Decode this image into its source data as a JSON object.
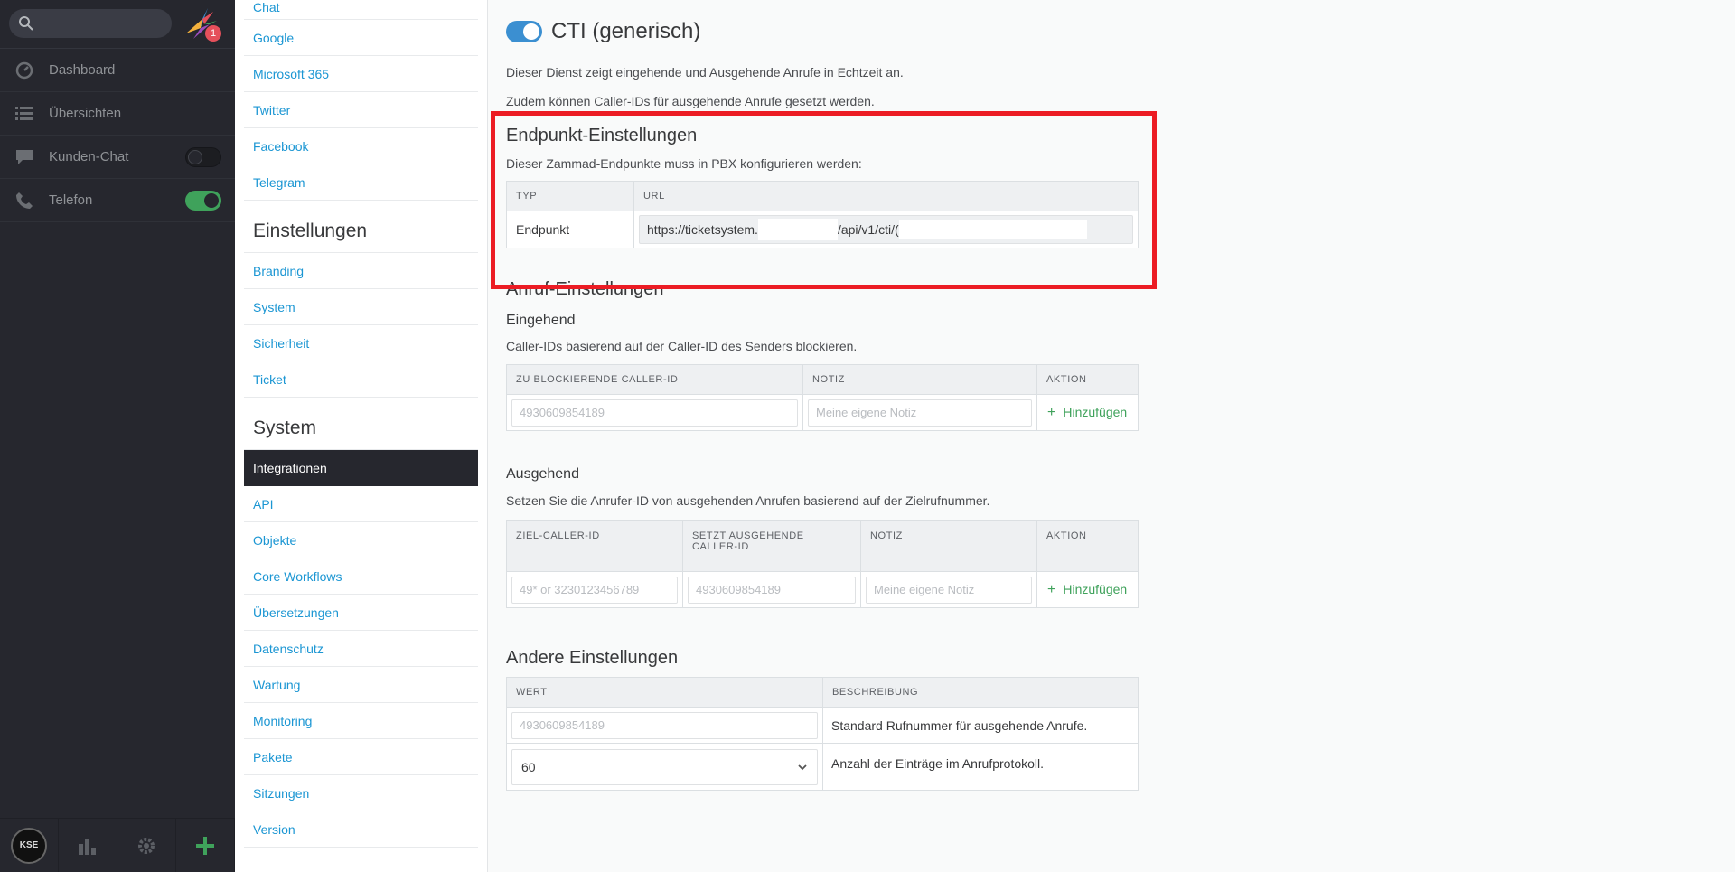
{
  "nav": {
    "search_placeholder": "",
    "notification_count": "1",
    "items": [
      {
        "label": "Dashboard",
        "icon": "dashboard-icon"
      },
      {
        "label": "Übersichten",
        "icon": "list-icon"
      },
      {
        "label": "Kunden-Chat",
        "icon": "chat-icon",
        "toggle": "off"
      },
      {
        "label": "Telefon",
        "icon": "phone-icon",
        "toggle": "on"
      }
    ],
    "bottom": [
      "avatar",
      "reports-icon",
      "gear-icon",
      "plus-icon"
    ],
    "avatar_text": "KSE"
  },
  "sidebar": {
    "channels": [
      "Chat",
      "Google",
      "Microsoft 365",
      "Twitter",
      "Facebook",
      "Telegram"
    ],
    "group_settings": "Einstellungen",
    "settings": [
      "Branding",
      "System",
      "Sicherheit",
      "Ticket"
    ],
    "group_system": "System",
    "system": [
      "Integrationen",
      "API",
      "Objekte",
      "Core Workflows",
      "Übersetzungen",
      "Datenschutz",
      "Wartung",
      "Monitoring",
      "Pakete",
      "Sitzungen",
      "Version"
    ]
  },
  "main": {
    "title": "CTI (generisch)",
    "enabled": true,
    "desc1": "Dieser Dienst zeigt eingehende und Ausgehende Anrufe in Echtzeit an.",
    "desc2": "Zudem können Caller-IDs für ausgehende Anrufe gesetzt werden.",
    "endpoint": {
      "heading": "Endpunkt-Einstellungen",
      "desc": "Dieser Zammad-Endpunkte muss in PBX konfigurieren werden:",
      "col_type": "TYP",
      "col_url": "URL",
      "row_type": "Endpunkt",
      "url_start": "https://ticketsystem.",
      "url_mid": "/api/v1/cti/",
      "url_tail": "("
    },
    "call": {
      "heading": "Anruf-Einstellungen",
      "incoming": {
        "heading": "Eingehend",
        "desc": "Caller-IDs basierend auf der Caller-ID des Senders blockieren.",
        "cols": [
          "ZU BLOCKIERENDE CALLER-ID",
          "NOTIZ",
          "AKTION"
        ],
        "callerid_placeholder": "4930609854189",
        "note_placeholder": "Meine eigene Notiz",
        "add_label": "Hinzufügen"
      },
      "outgoing": {
        "heading": "Ausgehend",
        "desc": "Setzen Sie die Anrufer-ID von ausgehenden Anrufen basierend auf der Zielrufnummer.",
        "cols": [
          "ZIEL-CALLER-ID",
          "SETZT AUSGEHENDE CALLER-ID",
          "NOTIZ",
          "AKTION"
        ],
        "dest_placeholder": "49* or 3230123456789",
        "callerid_placeholder": "4930609854189",
        "note_placeholder": "Meine eigene Notiz",
        "add_label": "Hinzufügen"
      }
    },
    "other": {
      "heading": "Andere Einstellungen",
      "cols": [
        "WERT",
        "BESCHREIBUNG"
      ],
      "default_placeholder": "4930609854189",
      "default_desc": "Standard Rufnummer für ausgehende Anrufe.",
      "log_value": "60",
      "log_desc": "Anzahl der Einträge im Anrufprotokoll."
    }
  },
  "colors": {
    "accent": "#1b96d3",
    "green": "#3fa25b",
    "highlight": "#ec1c24",
    "nav_bg": "#26272e"
  }
}
